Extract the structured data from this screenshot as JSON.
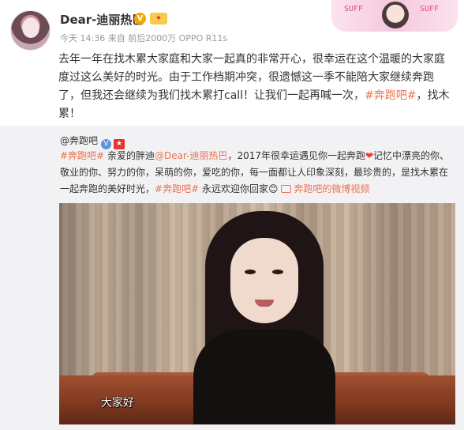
{
  "post": {
    "username": "Dear-迪丽热巴",
    "verified_badge": "V",
    "meta": "今天 14:36 来自 前后2000万 OPPO R11s",
    "body_text_1": "去年一年在找木累大家庭和大家一起真的非常开心，很幸运在这个温暖的大家庭度过这么美好的时光。由于工作档期冲突，很遗憾这一季不能陪大家继续奔跑了，但我还会继续为我们找木累打call！让我们一起再喊一次，",
    "body_topic": "#奔跑吧#",
    "body_text_2": "，找木累！",
    "decor_tags": [
      "SUFF",
      "SUFF"
    ]
  },
  "repost": {
    "name": "@奔跑吧",
    "verified_badge": "V",
    "red_badge": "★",
    "topic_1": "#奔跑吧#",
    "text_1": " 亲爱的胖迪",
    "mention": "@Dear-迪丽热巴",
    "text_2": "，2017年很幸运遇见你一起奔跑",
    "heart": "❤",
    "text_3": "记忆中漂亮的你、敬业的你、努力的你，呆萌的你，爱吃的你，每一面都让人印象深刻，最珍贵的，是找木累在一起奔跑的美好时光，",
    "topic_2": "#奔跑吧#",
    "text_4": " 永远欢迎你回家",
    "emoji": "😊",
    "video_link": "奔跑吧的微博视频"
  },
  "video": {
    "subtitle": "大家好"
  },
  "icons": {
    "verified": "verified-v-icon",
    "vip": "vip-badge-icon",
    "video": "video-icon",
    "heart": "heart-icon"
  },
  "colors": {
    "topic": "#eb7350",
    "verified_orange": "#f3a700",
    "verified_blue": "#5c97d5",
    "repost_bg": "#f2f2f5"
  }
}
